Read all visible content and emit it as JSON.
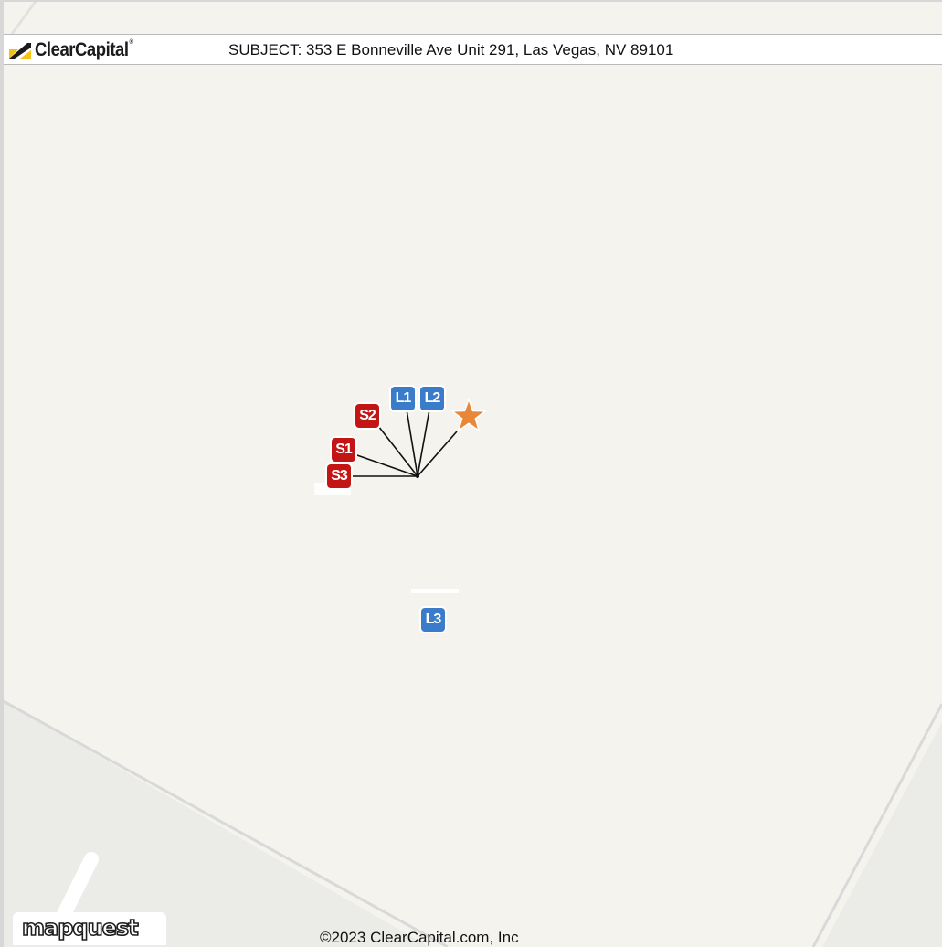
{
  "header": {
    "brand": "ClearCapital",
    "brand_mark": "®",
    "subject_text": "SUBJECT: 353 E Bonneville Ave Unit 291, Las Vegas, NV 89101"
  },
  "markers": {
    "sales": [
      {
        "label": "S1"
      },
      {
        "label": "S2"
      },
      {
        "label": "S3"
      }
    ],
    "listings": [
      {
        "label": "L1"
      },
      {
        "label": "L2"
      },
      {
        "label": "L3"
      }
    ],
    "subject_icon": "star-icon"
  },
  "footer": {
    "map_provider": "mapquest",
    "copyright": "©2023 ClearCapital.com, Inc"
  },
  "colors": {
    "sale_marker": "#c41515",
    "listing_marker": "#3a7cc9",
    "subject_star": "#e8873a",
    "map_background": "#f5f3ee"
  }
}
